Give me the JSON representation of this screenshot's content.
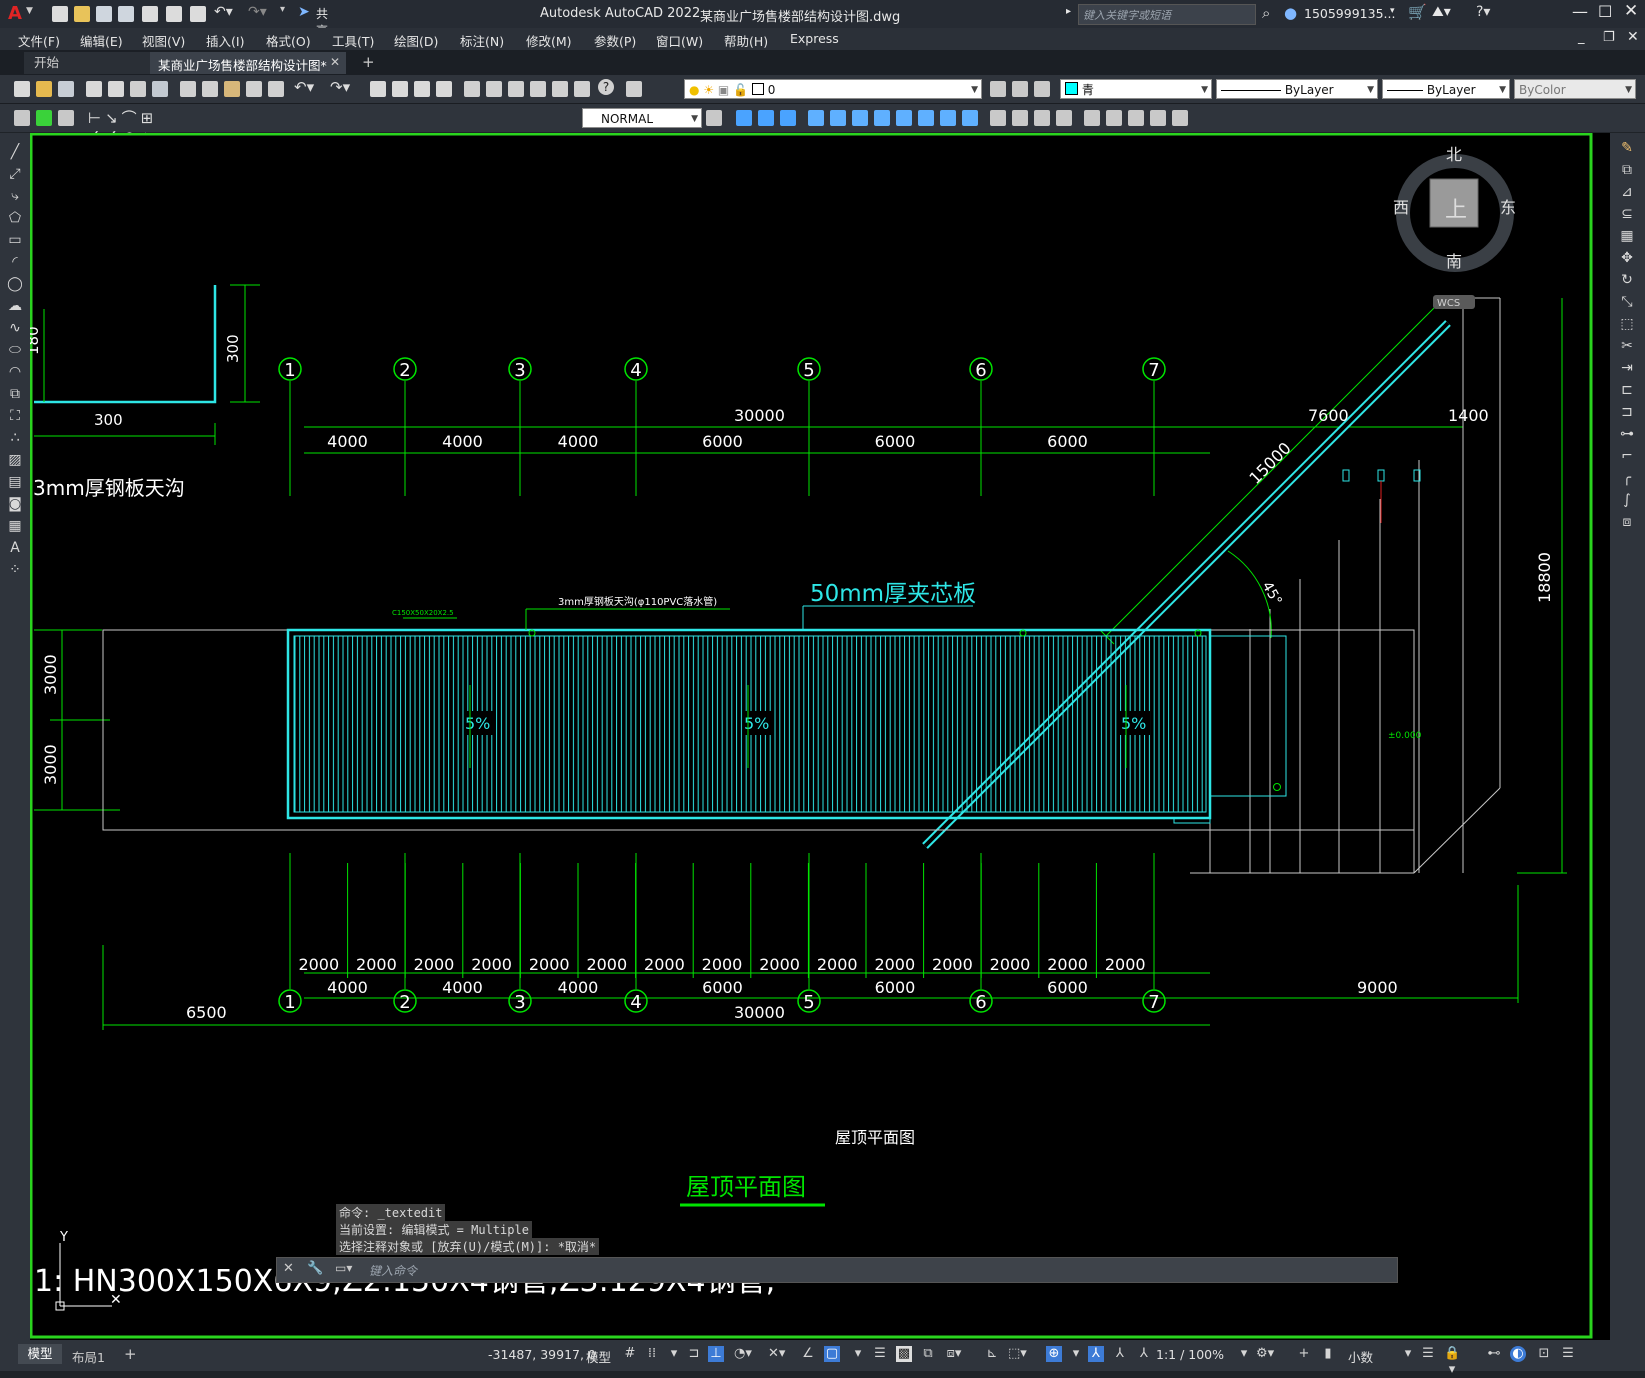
{
  "app": {
    "logo": "A",
    "title": "Autodesk AutoCAD 2022",
    "document": "某商业广场售楼部结构设计图.dwg",
    "search_placeholder": "键入关键字或短语",
    "user": "1505999135...",
    "share_label": "共享"
  },
  "menu": [
    "文件(F)",
    "编辑(E)",
    "视图(V)",
    "插入(I)",
    "格式(O)",
    "工具(T)",
    "绘图(D)",
    "标注(N)",
    "修改(M)",
    "参数(P)",
    "窗口(W)",
    "帮助(H)",
    "Express"
  ],
  "tabs": {
    "start": "开始",
    "active": "某商业广场售楼部结构设计图*"
  },
  "toolbar": {
    "layer_value": "0",
    "color_value": "青",
    "linetype_value": "ByLayer",
    "lineweight_value": "ByLayer",
    "plotstyle_value": "ByColor",
    "dimstyle_value": "NORMAL"
  },
  "viewcube": {
    "north": "北",
    "south": "南",
    "east": "东",
    "west": "西",
    "top": "上",
    "wcs": "WCS"
  },
  "drawing": {
    "gutter_label": "3mm厚钢板天沟",
    "gutter_dims": [
      "180",
      "300",
      "300"
    ],
    "panel_label": "50mm厚夹芯板",
    "pipe_note": "3mm厚钢板天沟(φ110PVC落水管)",
    "small_note": "C150X50X20X2.5",
    "slopes": [
      "5%",
      "5%",
      "5%"
    ],
    "top_total": "30000",
    "top_spans": [
      "4000",
      "4000",
      "4000",
      "6000",
      "6000",
      "6000"
    ],
    "right_dims": [
      "7600",
      "1400"
    ],
    "diag_dim": "15000",
    "angle": "45°",
    "vertical_total": "18800",
    "left_dims": [
      "3000",
      "3000"
    ],
    "elevation": "±0.000",
    "axis_labels": [
      "1",
      "2",
      "3",
      "4",
      "5",
      "6",
      "7"
    ],
    "bottom_small": [
      "2000",
      "2000",
      "2000",
      "2000",
      "2000",
      "2000",
      "2000",
      "2000",
      "2000",
      "2000",
      "2000",
      "2000",
      "2000",
      "2000",
      "2000"
    ],
    "bottom_spans": [
      "4000",
      "4000",
      "4000",
      "6000",
      "6000",
      "6000"
    ],
    "bottom_extra": "9000",
    "bottom_left": "6500",
    "bottom_total": "30000",
    "plan_title_white": "屋顶平面图",
    "plan_title_green": "屋顶平面图",
    "big_text": "1:     HN300X150X6X9;Z2:150X4钢管;Z3:129X4钢管;",
    "ucs_y": "Y"
  },
  "command": {
    "history": [
      "命令:  _textedit",
      "当前设置: 编辑模式 = Multiple",
      "选择注释对象或 [放弃(U)/模式(M)]: *取消*"
    ],
    "placeholder": "键入命令"
  },
  "status": {
    "layout_tabs": [
      "模型",
      "布局1"
    ],
    "coords": "-31487, 39917, 0",
    "model": "模型",
    "scale": "1:1 / 100%",
    "units": "小数"
  },
  "colors": {
    "green": "#00e400",
    "cyan": "#2ee6e6",
    "canvas": "#000000",
    "frame": "#2ad41e"
  }
}
